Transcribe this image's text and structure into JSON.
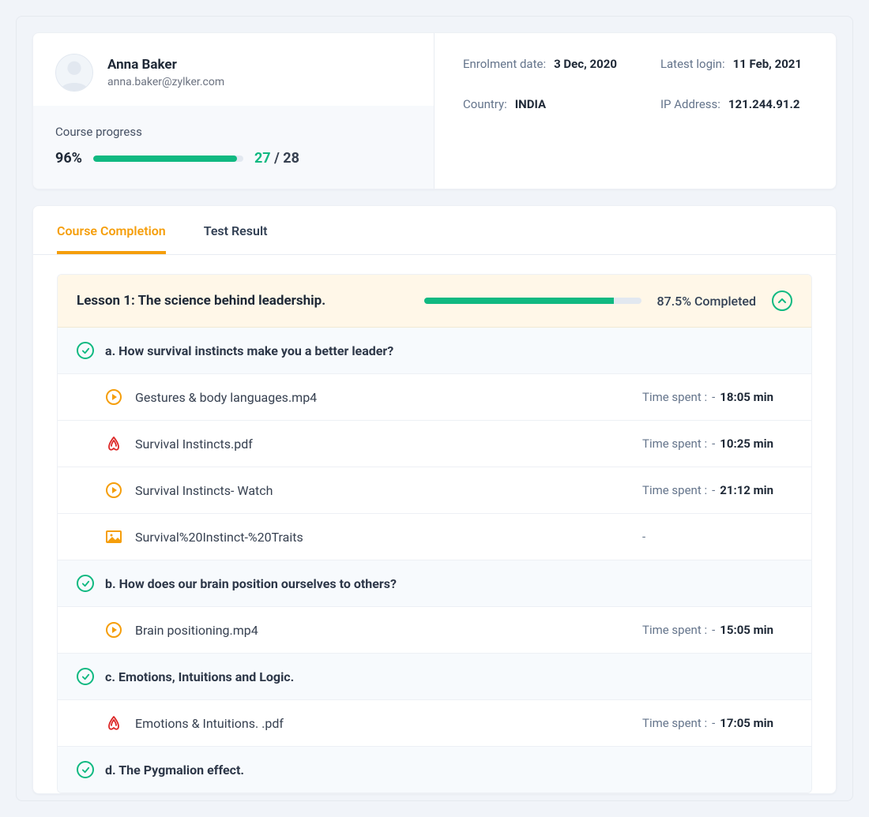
{
  "user": {
    "name": "Anna Baker",
    "email": "anna.baker@zylker.com"
  },
  "meta": {
    "enrolment_label": "Enrolment date:",
    "enrolment_value": "3 Dec, 2020",
    "login_label": "Latest login:",
    "login_value": "11 Feb, 2021",
    "country_label": "Country:",
    "country_value": "INDIA",
    "ip_label": "IP Address:",
    "ip_value": "121.244.91.2"
  },
  "progress": {
    "label": "Course progress",
    "percent_text": "96%",
    "percent_width": "96%",
    "current": "27",
    "sep": " / ",
    "total": "28"
  },
  "tabs": {
    "active": "Course Completion",
    "inactive": "Test Result"
  },
  "lesson": {
    "title": "Lesson 1: The science behind leadership.",
    "percent_text": "87.5% Completed",
    "percent_width": "87.5%"
  },
  "sections": [
    {
      "title": "a. How survival instincts make you a better leader?",
      "items": [
        {
          "type": "video",
          "name": "Gestures & body languages.mp4",
          "time_label": "Time spent :",
          "dash": "-",
          "time": "18:05 min"
        },
        {
          "type": "pdf",
          "name": "Survival Instincts.pdf",
          "time_label": "Time spent :",
          "dash": "-",
          "time": "10:25 min"
        },
        {
          "type": "video",
          "name": "Survival Instincts- Watch",
          "time_label": "Time spent :",
          "dash": "-",
          "time": "21:12 min"
        },
        {
          "type": "image",
          "name": "Survival%20Instinct-%20Traits",
          "time_label": "",
          "dash": "-",
          "time": ""
        }
      ]
    },
    {
      "title": "b. How does our brain position ourselves to others?",
      "items": [
        {
          "type": "video",
          "name": "Brain positioning.mp4",
          "time_label": "Time spent :",
          "dash": "-",
          "time": "15:05 min"
        }
      ]
    },
    {
      "title": "c. Emotions, Intuitions and Logic.",
      "items": [
        {
          "type": "pdf",
          "name": "Emotions & Intuitions. .pdf",
          "time_label": "Time spent :",
          "dash": "-",
          "time": "17:05 min"
        }
      ]
    },
    {
      "title": "d. The Pygmalion effect.",
      "items": []
    }
  ]
}
